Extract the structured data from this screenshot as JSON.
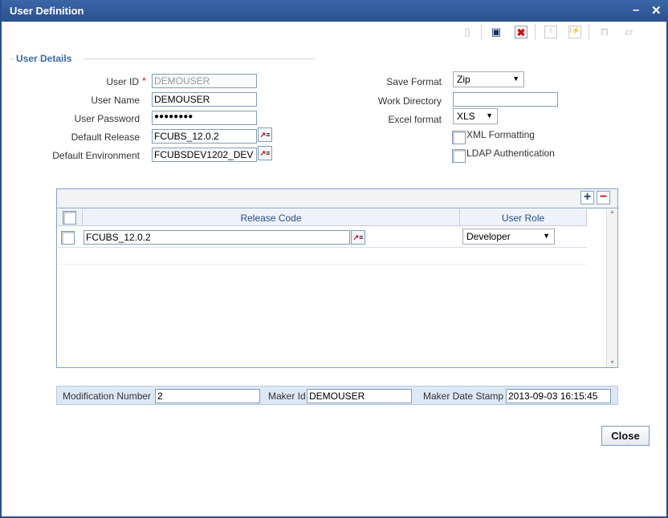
{
  "window": {
    "title": "User Definition",
    "minimize": "–",
    "close": "✕"
  },
  "toolbar": [
    {
      "name": "new-icon",
      "glyph": "▯",
      "enabled": false
    },
    {
      "name": "save-icon",
      "glyph": "💾",
      "enabled": true
    },
    {
      "name": "delete-icon",
      "glyph": "✖",
      "enabled": true
    },
    {
      "name": "copy-icon",
      "glyph": "I",
      "enabled": false
    },
    {
      "name": "authorize-icon",
      "glyph": "I",
      "enabled": false
    },
    {
      "name": "unlock-icon",
      "glyph": "🔓",
      "enabled": false
    },
    {
      "name": "open-icon",
      "glyph": "📂",
      "enabled": false
    }
  ],
  "section": "User Details",
  "fields": {
    "user_id": {
      "label": "User ID",
      "required": "*",
      "value": "DEMOUSER"
    },
    "user_name": {
      "label": "User Name",
      "value": "DEMOUSER"
    },
    "user_password": {
      "label": "User Password",
      "value": "●●●●●●●●"
    },
    "default_release": {
      "label": "Default Release",
      "value": "FCUBS_12.0.2"
    },
    "default_environment": {
      "label": "Default Environment",
      "value": "FCUBSDEV1202_DEV"
    },
    "save_format": {
      "label": "Save Format",
      "value": "Zip"
    },
    "work_directory": {
      "label": "Work Directory",
      "value": ""
    },
    "excel_format": {
      "label": "Excel format",
      "value": "XLS"
    },
    "xml_formatting": {
      "label": "XML Formatting",
      "checked": false
    },
    "ldap_authentication": {
      "label": "LDAP Authentication",
      "checked": false
    }
  },
  "grid": {
    "columns": [
      "Release Code",
      "User Role"
    ],
    "rows": [
      {
        "release_code": "FCUBS_12.0.2",
        "user_role": "Developer"
      }
    ],
    "add": "+",
    "remove": "−"
  },
  "footer": {
    "modification_number": {
      "label": "Modification Number",
      "value": "2"
    },
    "maker_id": {
      "label": "Maker Id",
      "value": "DEMOUSER"
    },
    "maker_date_stamp": {
      "label": "Maker Date Stamp",
      "value": "2013-09-03 16:15:45"
    }
  },
  "close_label": "Close"
}
